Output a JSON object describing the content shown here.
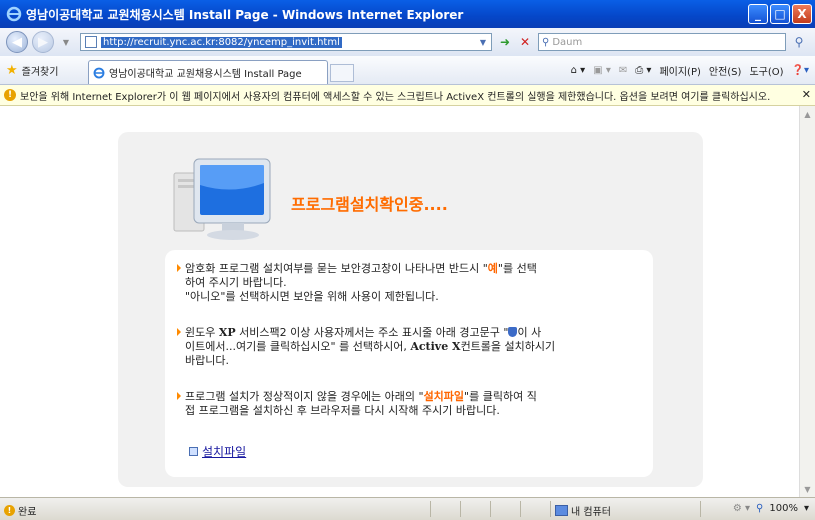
{
  "window": {
    "title": "영남이공대학교 교원채용시스템 Install Page - Windows Internet Explorer",
    "minimize": "_",
    "maximize": "□",
    "close": "X"
  },
  "address": {
    "url": "http://recruit.ync.ac.kr:8082/yncemp_invit.html",
    "search_placeholder": "Daum"
  },
  "favorites": {
    "label": "즐겨찾기",
    "tab_title": "영남이공대학교 교원채용시스템 Install Page"
  },
  "command_bar": {
    "page": "페이지(P)",
    "safety": "안전(S)",
    "tools": "도구(O)"
  },
  "info_bar": {
    "message": "보안을 위해 Internet Explorer가 이 웹 페이지에서 사용자의 컴퓨터에 액세스할 수 있는 스크립트나 ActiveX 컨트롤의 실행을 제한했습니다. 옵션을 보려면 여기를 클릭하십시오."
  },
  "page": {
    "heading": "프로그램설치확인중....",
    "items": [
      {
        "l1a": "암호화 프로그램 설치여부를 묻는 보안경고창이 나타나면 반드시 \"",
        "l1hi": "예",
        "l1b": "\"를 선택",
        "l2": "하여 주시기 바랍니다.",
        "l3": "\"아니오\"를 선택하시면 보안을 위해 사용이 제한됩니다."
      },
      {
        "l1a": "윈도우 ",
        "xp": "XP",
        "l1b": " 서비스팩2 이상 사용자께서는 주소 표시줄 아래 경고문구 \"",
        "l1c": "이 사",
        "l2a": "이트에서...여기를 클릭하십시오\" 를 선택하시어, ",
        "activex": "Active X",
        "l2b": "컨트롤을 설치하시기",
        "l3": "바랍니다."
      },
      {
        "l1a": "프로그램 설치가 정상적이지 않을 경우에는 아래의 \"",
        "l1hi": "설치파일",
        "l1b": "\"를 클릭하여 직",
        "l2": "접 프로그램을 설치하신 후 브라우저를 다시 시작해 주시기 바랍니다."
      }
    ],
    "install_link": "설치파일"
  },
  "status": {
    "done": "완료",
    "zone": "내 컴퓨터",
    "zoom": "100%"
  }
}
